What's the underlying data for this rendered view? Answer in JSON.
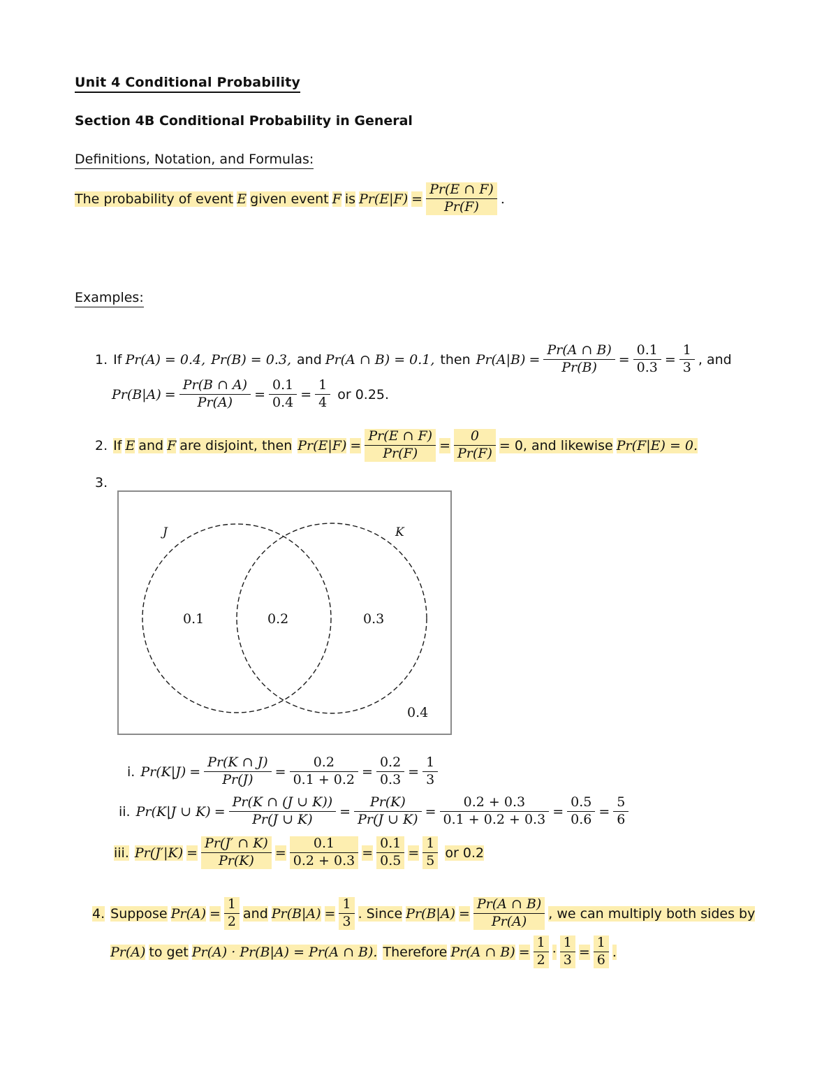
{
  "document": {
    "title": "Unit 4 Conditional Probability",
    "section": "Section 4B Conditional Probability in General",
    "definitions_heading": "Definitions, Notation, and Formulas:",
    "examples_heading": "Examples:"
  },
  "definition": {
    "lead": "The probability of event",
    "event_e": "E",
    "given": "given event",
    "event_f": "F",
    "is": "is",
    "lhs": "Pr(E|F)",
    "equals": "=",
    "numerator": "Pr(E ∩ F)",
    "denominator": "Pr(F)",
    "period": "."
  },
  "examples": [
    {
      "number": "1.",
      "highlighted": false,
      "line1": {
        "if": "If",
        "pa": "Pr(A) = 0.4,",
        "pb": "Pr(B) = 0.3,",
        "and": "and",
        "pab": "Pr(A ∩ B) = 0.1,",
        "then": "then",
        "lhs": "Pr(A|B)",
        "eq1": "=",
        "f1_num": "Pr(A ∩ B)",
        "f1_den": "Pr(B)",
        "eq2": "=",
        "f2_num": "0.1",
        "f2_den": "0.3",
        "eq3": "=",
        "f3_num": "1",
        "f3_den": "3",
        "tail": ", and"
      },
      "line2": {
        "lhs": "Pr(B|A)",
        "eq1": "=",
        "f1_num": "Pr(B ∩ A)",
        "f1_den": "Pr(A)",
        "eq2": "=",
        "f2_num": "0.1",
        "f2_den": "0.4",
        "eq3": "=",
        "f3_num": "1",
        "f3_den": "4",
        "tail": "or 0.25."
      }
    },
    {
      "number": "2.",
      "highlighted": true,
      "line1": {
        "if": "If",
        "e": "E",
        "and": "and",
        "f": "F",
        "are_disjoint_then": "are disjoint, then",
        "lhs": "Pr(E|F)",
        "eq1": "=",
        "f1_num": "Pr(E ∩ F)",
        "f1_den": "Pr(F)",
        "eq2": "=",
        "f2_num": "0",
        "f2_den": "Pr(F)",
        "eq3": "= 0, and likewise",
        "tail": "Pr(F|E) = 0."
      }
    },
    {
      "number": "3.",
      "highlighted": false
    },
    {
      "number": "4.",
      "highlighted": true,
      "line1": {
        "suppose": "Suppose",
        "pa": "Pr(A)",
        "eq1": "=",
        "f1_num": "1",
        "f1_den": "2",
        "and": "and",
        "pba": "Pr(B|A)",
        "eq2": "=",
        "f2_num": "1",
        "f2_den": "3",
        "since": ". Since",
        "pba2": "Pr(B|A)",
        "eq3": "=",
        "f3_num": "Pr(A ∩ B)",
        "f3_den": "Pr(A)",
        "tail": ", we can multiply both sides by"
      },
      "line2": {
        "pa": "Pr(A)",
        "to_get": "to get",
        "identity": "Pr(A) · Pr(B|A) = Pr(A ∩ B).",
        "therefore": "Therefore",
        "pab": "Pr(A ∩ B)",
        "eq1": "=",
        "f1_num": "1",
        "f1_den": "2",
        "dot": "·",
        "f2_num": "1",
        "f2_den": "3",
        "eq2": "=",
        "f3_num": "1",
        "f3_den": "6",
        "period": "."
      }
    }
  ],
  "venn": {
    "set_left_label": "J",
    "set_right_label": "K",
    "region_left_only": "0.1",
    "region_intersection": "0.2",
    "region_right_only": "0.3",
    "region_outside": "0.4",
    "border_color": "#8a8a8a",
    "stroke_color": "#1a1a1a"
  },
  "venn_subitems": [
    {
      "label": "i.",
      "highlighted": false,
      "lhs": "Pr(K|J)",
      "eq1": "=",
      "f1_num": "Pr(K ∩ J)",
      "f1_den": "Pr(J)",
      "eq2": "=",
      "f2_num": "0.2",
      "f2_den": "0.1 + 0.2",
      "eq3": "=",
      "f3_num": "0.2",
      "f3_den": "0.3",
      "eq4": "=",
      "f4_num": "1",
      "f4_den": "3",
      "tail": ""
    },
    {
      "label": "ii.",
      "highlighted": false,
      "lhs": "Pr(K|J ∪ K)",
      "eq1": "=",
      "f1_num": "Pr(K ∩ (J ∪ K))",
      "f1_den": "Pr(J ∪ K)",
      "eq2": "=",
      "f2_num": "Pr(K)",
      "f2_den": "Pr(J ∪ K)",
      "eq3": "=",
      "f3_num": "0.2 + 0.3",
      "f3_den": "0.1 + 0.2 + 0.3",
      "eq4": "=",
      "f4_num": "0.5",
      "f4_den": "0.6",
      "eq5": "=",
      "f5_num": "5",
      "f5_den": "6",
      "tail": ""
    },
    {
      "label": "iii.",
      "highlighted": true,
      "lhs": "Pr(J′|K)",
      "eq1": "=",
      "f1_num": "Pr(J′ ∩ K)",
      "f1_den": "Pr(K)",
      "eq2": "=",
      "f2_num": "0.1",
      "f2_den": "0.2 + 0.3",
      "eq3": "=",
      "f3_num": "0.1",
      "f3_den": "0.5",
      "eq4": "=",
      "f4_num": "1",
      "f4_den": "5",
      "tail": "or 0.2"
    }
  ],
  "colors": {
    "highlight": "#fdeeb0",
    "text": "#111111",
    "venn_border": "#8a8a8a"
  }
}
